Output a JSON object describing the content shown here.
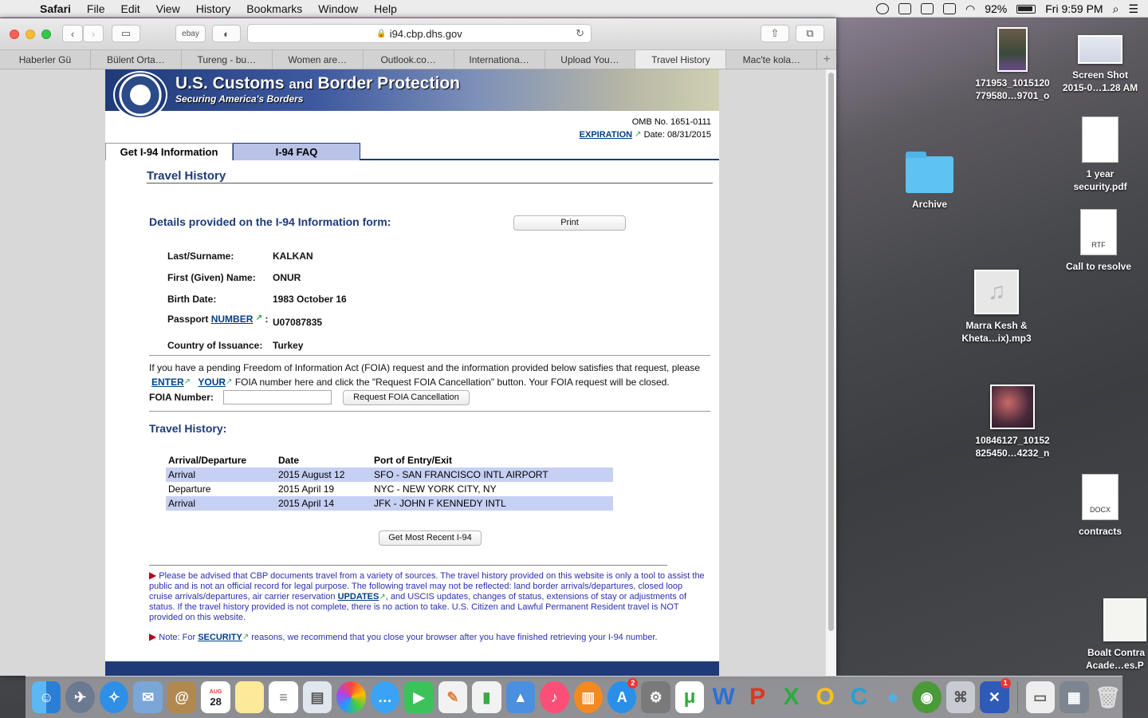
{
  "menubar": {
    "apple": "",
    "items": [
      "Safari",
      "File",
      "Edit",
      "View",
      "History",
      "Bookmarks",
      "Window",
      "Help"
    ],
    "battery": "92%",
    "clock": "Fri 9:59 PM"
  },
  "browser": {
    "favorite_label": "ebay",
    "url": "i94.cbp.dhs.gov",
    "tabs": [
      "Haberler Gü",
      "Bülent Orta…",
      "Tureng - bu…",
      "Women are…",
      "Outlook.co…",
      "Internationa…",
      "Upload You…",
      "Travel History",
      "Mac'te kola…"
    ],
    "active_tab": "Travel History"
  },
  "page": {
    "banner_title_a": "U.S. Customs",
    "banner_title_and": "and",
    "banner_title_b": "Border Protection",
    "banner_subtitle": "Securing America's Borders",
    "omb": "OMB No. 1651-0111",
    "expiration_label": "EXPIRATION",
    "expiration_date": "Date: 08/31/2015",
    "nav_tab_1": "Get I-94 Information",
    "nav_tab_2": "I-94 FAQ",
    "heading": "Travel History",
    "details_heading": "Details provided on the I-94 Information form:",
    "print_button": "Print",
    "fields": {
      "surname_label": "Last/Surname:",
      "surname": "KALKAN",
      "given_label": "First (Given) Name:",
      "given": "ONUR",
      "birth_label": "Birth Date:",
      "birth": "1983 October 16",
      "passport_label_pre": "Passport",
      "passport_link": "NUMBER",
      "passport_colon": ":",
      "passport": "U07087835",
      "country_label": "Country of Issuance:",
      "country": "Turkey"
    },
    "foia": {
      "text_1": "If you have a pending Freedom of Information Act (FOIA) request and the information provided below satisfies that request, please",
      "link_enter": "ENTER",
      "link_your": "YOUR",
      "text_2": "FOIA number here and click the \"Request FOIA Cancellation\" button. Your FOIA request will be closed.",
      "number_label": "FOIA Number:",
      "number_value": "",
      "cancel_button": "Request FOIA Cancellation"
    },
    "history_heading": "Travel History:",
    "history_columns": [
      "Arrival/Departure",
      "Date",
      "Port of Entry/Exit"
    ],
    "history_rows": [
      [
        "Arrival",
        "2015 August 12",
        "SFO - SAN FRANCISCO INTL AIRPORT"
      ],
      [
        "Departure",
        "2015 April 19",
        "NYC - NEW YORK CITY, NY"
      ],
      [
        "Arrival",
        "2015 April 14",
        "JFK - JOHN F KENNEDY INTL"
      ]
    ],
    "recent_button": "Get Most Recent I-94",
    "notice_1_a": "Please be advised that CBP documents travel from a variety of sources. The travel history provided on this website is only a tool to assist the public and is not an official record for legal purpose. The following travel may not be reflected: land border arrivals/departures, closed loop cruise arrivals/departures, air carrier reservation",
    "notice_1_link": "UPDATES",
    "notice_1_b": ", and USCIS updates, changes of status, extensions of stay or adjustments of status. If the travel history provided is not complete, there is no action to take. U.S. Citizen and Lawful Permanent Resident travel is NOT provided on this website.",
    "notice_2_a": "Note: For",
    "notice_2_link": "SECURITY",
    "notice_2_b": "reasons, we recommend that you close your browser after you have finished retrieving your I-94 number."
  },
  "desktop": {
    "icons": [
      {
        "line1": "171953_1015120",
        "line2": "779580…9701_o"
      },
      {
        "line1": "Screen Shot",
        "line2": "2015-0…1.28 AM"
      },
      {
        "line1": "1 year",
        "line2": "security.pdf"
      },
      {
        "line1": "Archive",
        "line2": ""
      },
      {
        "line1": "Call to resolve",
        "line2": "",
        "badge": "RTF"
      },
      {
        "line1": "Marra Kesh &",
        "line2": "Kheta…ix).mp3"
      },
      {
        "line1": "10846127_10152",
        "line2": "825450…4232_n"
      },
      {
        "line1": "contracts",
        "line2": "",
        "badge": "DOCX"
      },
      {
        "line1": "Boalt Contra",
        "line2": "Acade…es.P"
      }
    ]
  },
  "dock": {
    "calendar_month": "AUG",
    "calendar_day": "28",
    "appstore_badge": "2",
    "last_badge": "1"
  },
  "colors": {
    "cbp_blue": "#1e3a78",
    "row_shade": "#c6d0f3",
    "notice_blue": "#2e2eb0",
    "notice_arrow": "#b00020",
    "external_link_green": "#2fa84f"
  }
}
